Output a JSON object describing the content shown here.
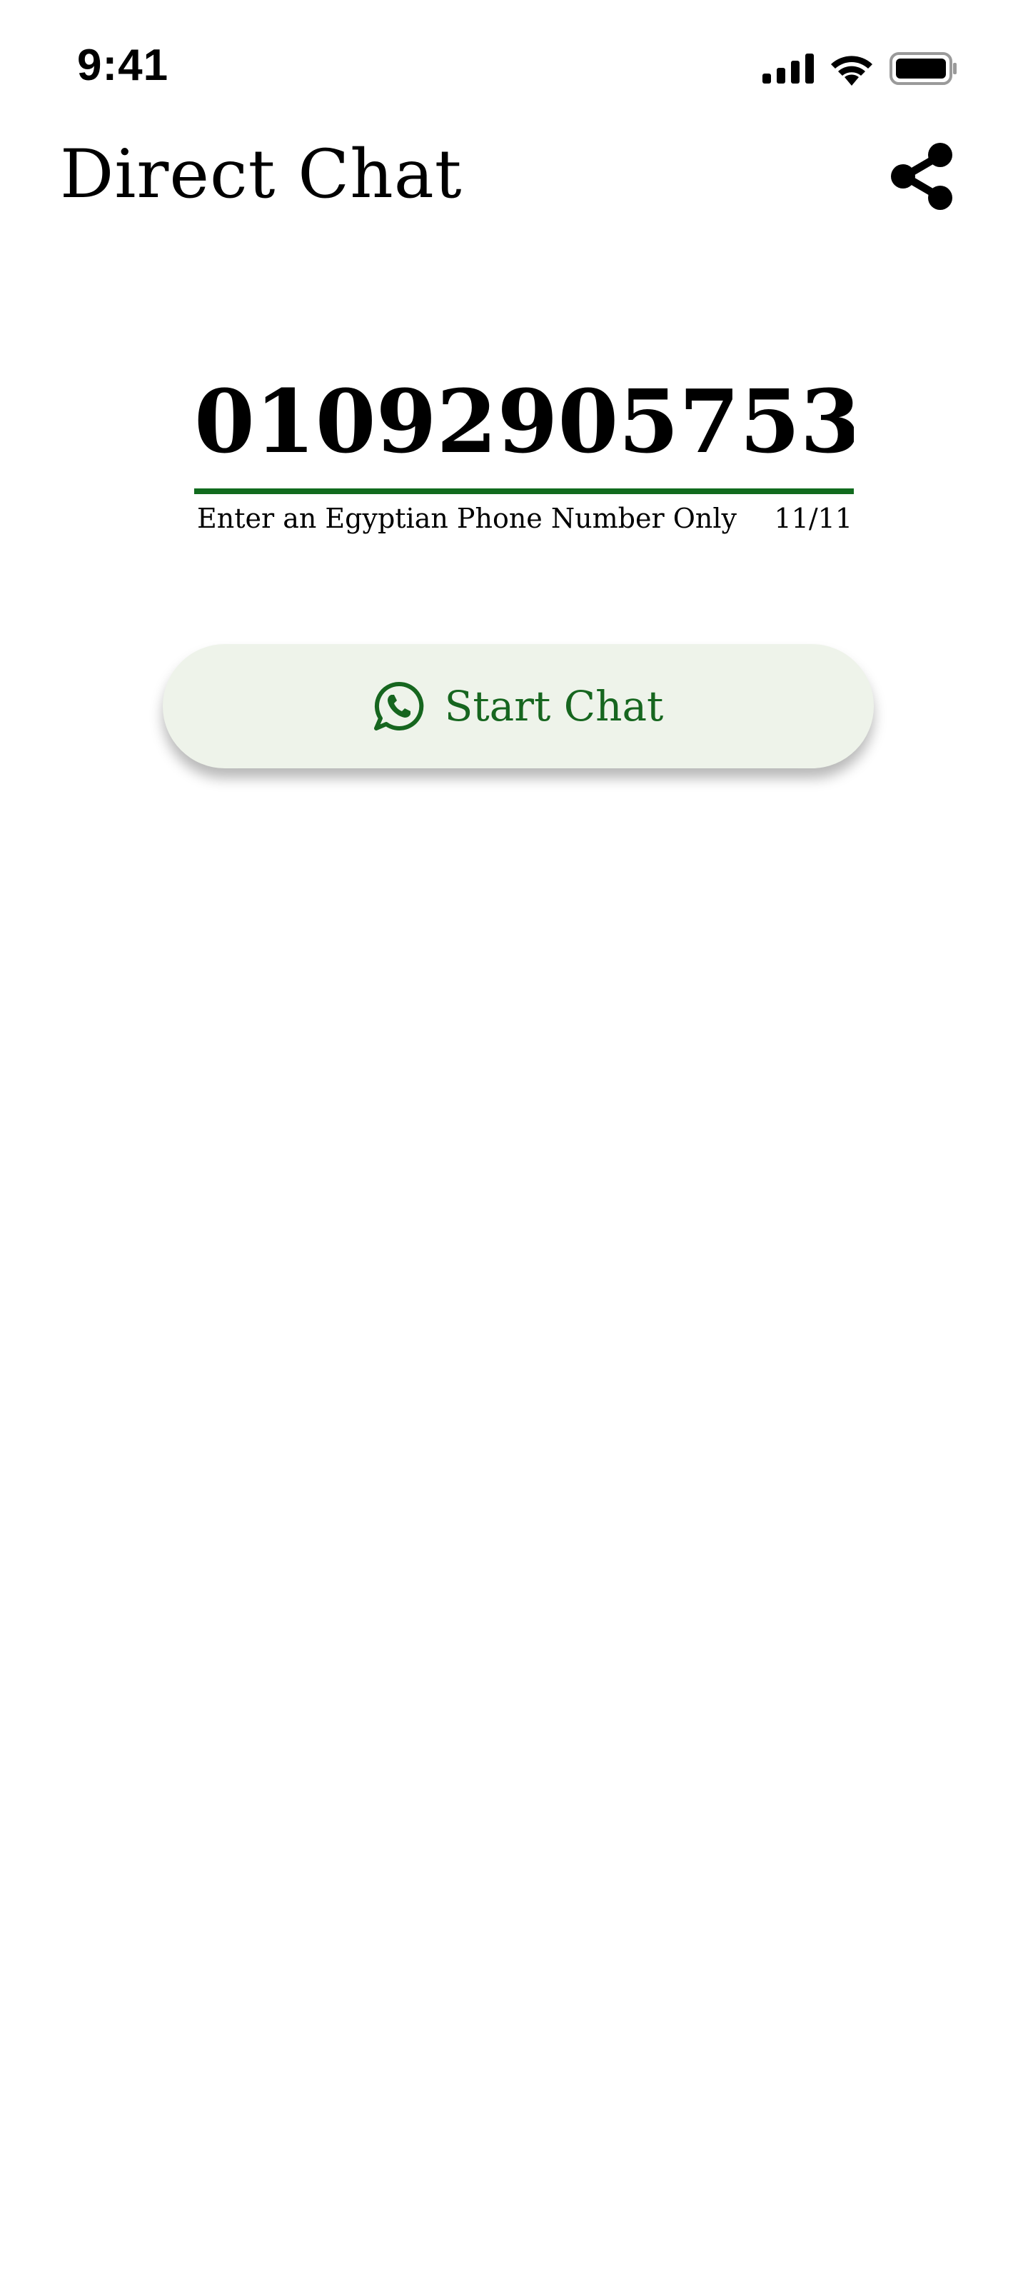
{
  "status_bar": {
    "time": "9:41",
    "icons": [
      "signal-icon",
      "wifi-icon",
      "battery-icon"
    ]
  },
  "app_bar": {
    "title": "Direct Chat",
    "share_icon": "share-icon"
  },
  "phone_field": {
    "value": "01092905753",
    "helper_text": "Enter an Egyptian Phone Number Only",
    "counter": "11/11"
  },
  "start_chat": {
    "label": "Start Chat",
    "icon": "whatsapp-icon"
  },
  "colors": {
    "accent": "#116b1e",
    "button_background": "#eef3ea",
    "button_text": "#16661f",
    "background": "#ffffff"
  }
}
